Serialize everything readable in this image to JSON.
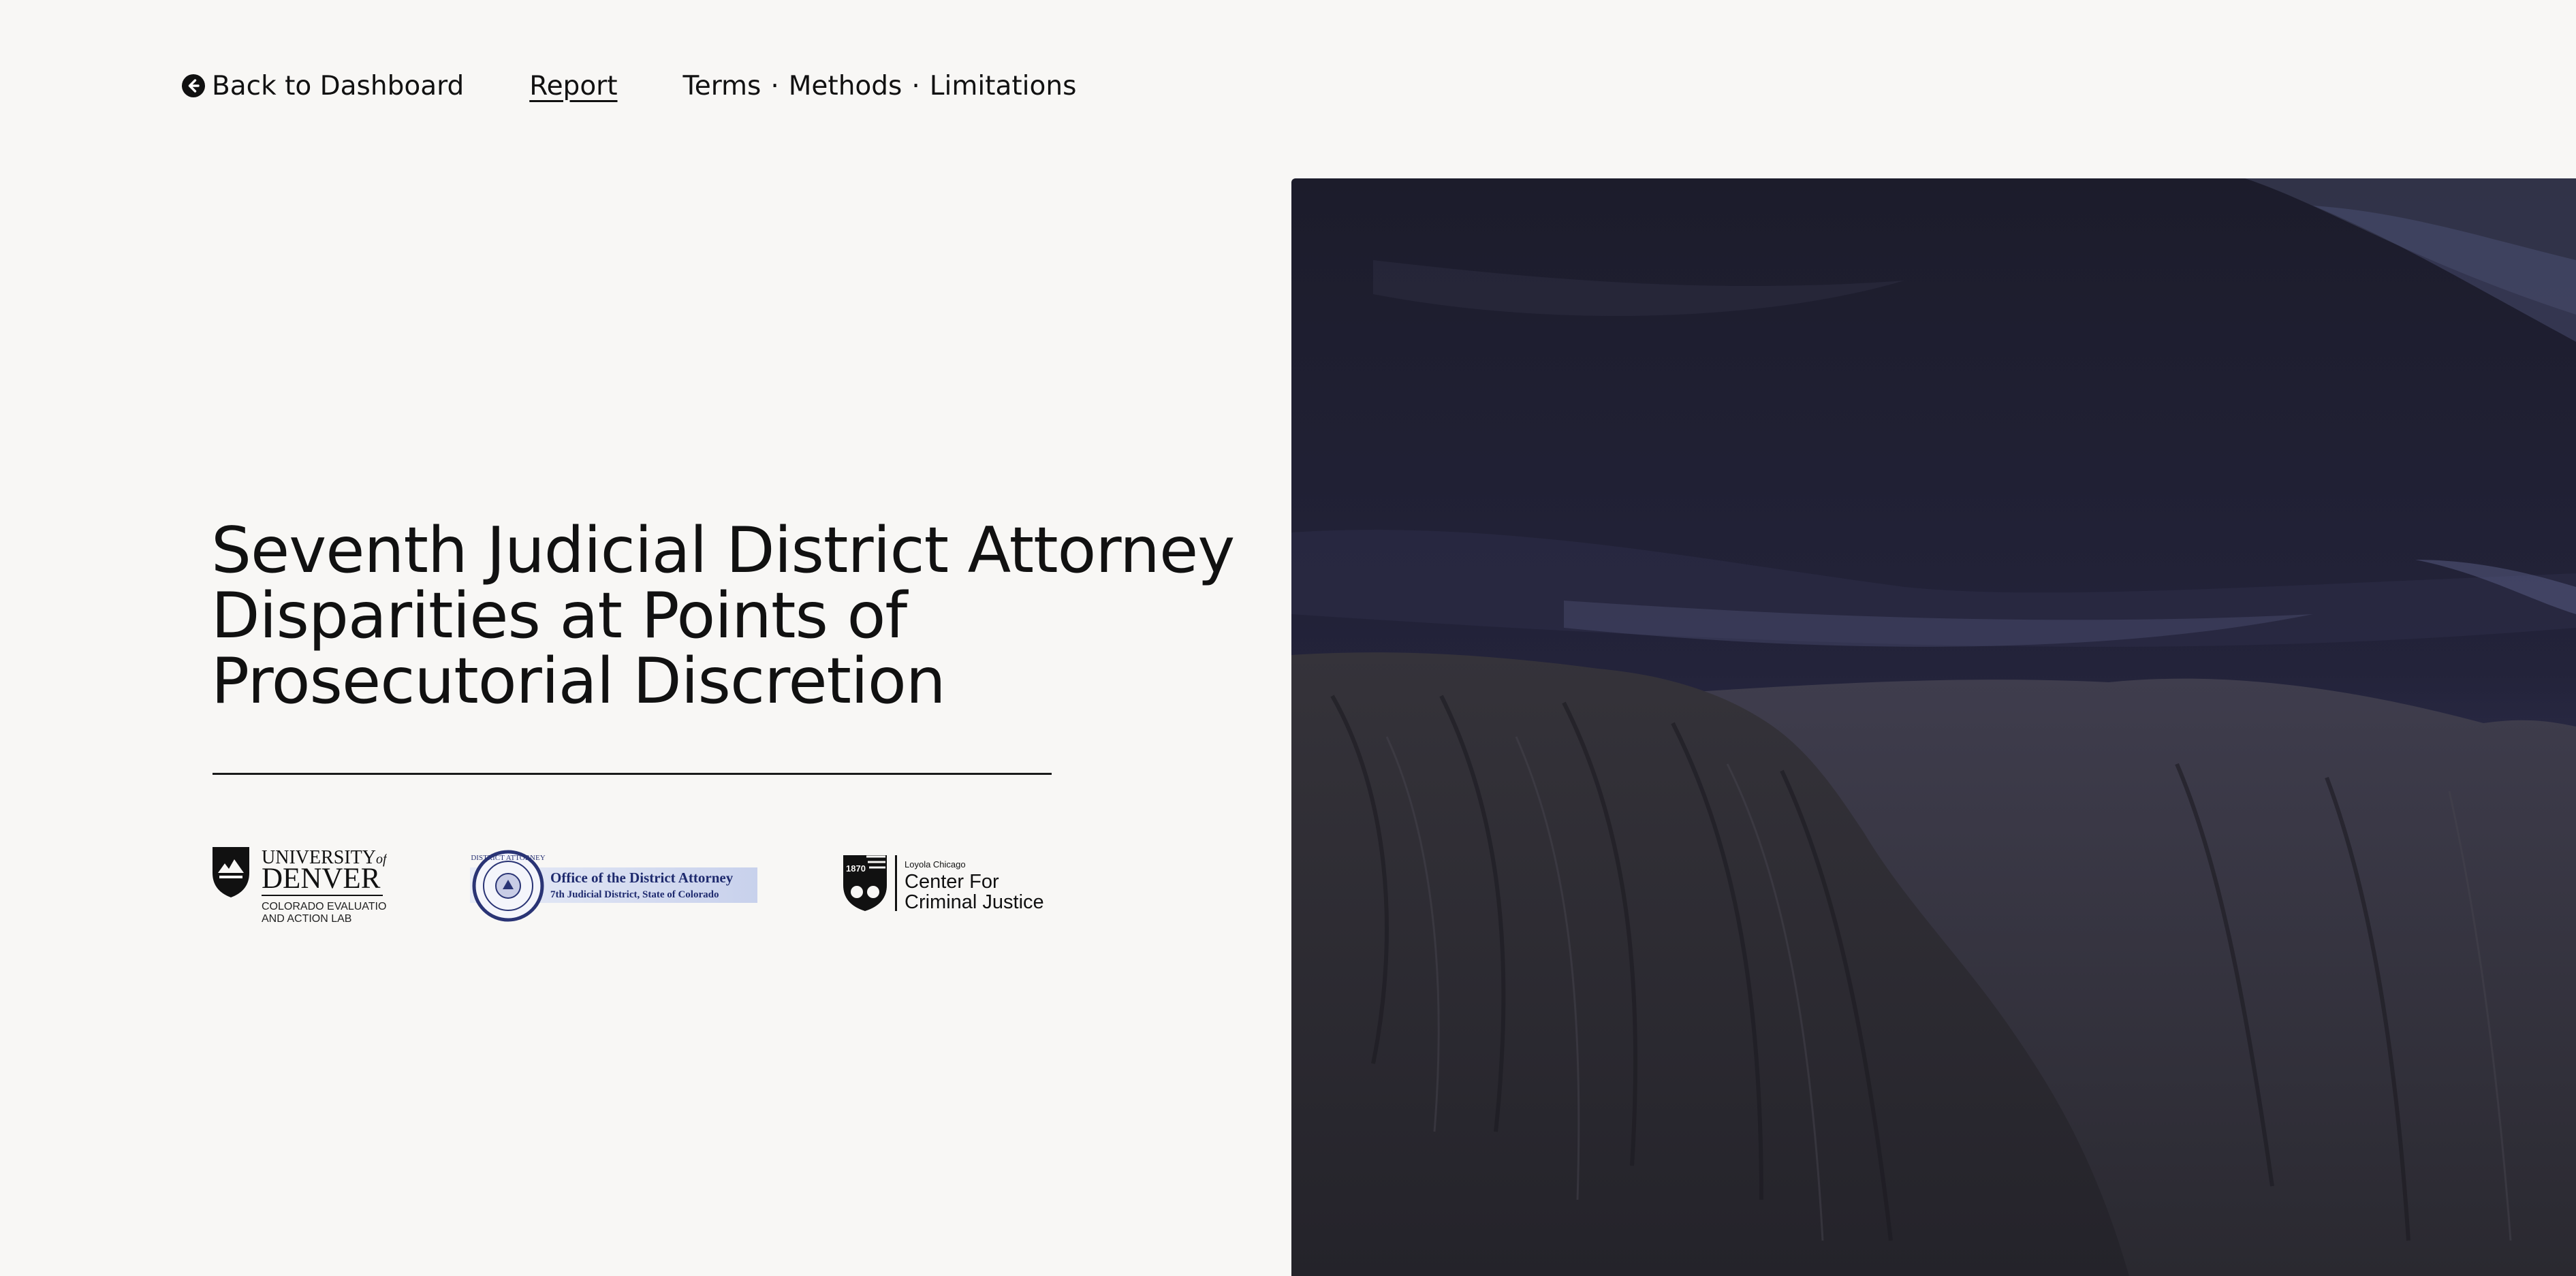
{
  "nav": {
    "back_label": "Back to Dashboard",
    "back_icon": "arrow-left-circle-icon",
    "report_label": "Report",
    "terms_label": "Terms",
    "methods_label": "Methods",
    "limitations_label": "Limitations",
    "separator": "·"
  },
  "title": {
    "line1": "Seventh Judicial District Attorney",
    "line2": "Disparities at Points of",
    "line3": "Prosecutorial Discretion"
  },
  "logos": {
    "du": {
      "line1": "UNIVERSITY",
      "of": "of",
      "line2": "DENVER",
      "sub1": "COLORADO EVALUATION",
      "sub2": "AND ACTION LAB"
    },
    "da": {
      "seal": "DISTRICT ATTORNEY",
      "line1": "Office of the District Attorney",
      "line2": "7th Judicial District, State of Colorado"
    },
    "luc": {
      "year": "1870",
      "small": "Loyola Chicago",
      "line1": "Center For",
      "line2": "Criminal Justice"
    }
  },
  "colors": {
    "background": "#f8f7f5",
    "text": "#111111",
    "hero_sky": "#22223a",
    "hero_rock": "#2e2d35"
  }
}
